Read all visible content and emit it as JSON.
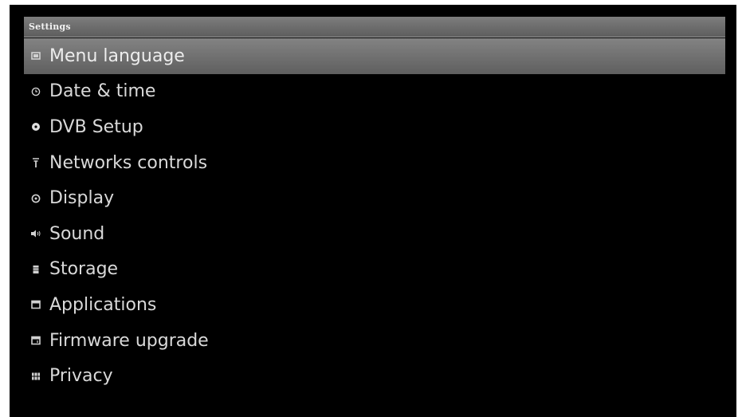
{
  "window": {
    "title": "Settings"
  },
  "menu": {
    "selected_index": 0,
    "items": [
      {
        "label": "Menu language",
        "icon": "flag-icon"
      },
      {
        "label": "Date & time",
        "icon": "clock-icon"
      },
      {
        "label": "DVB Setup",
        "icon": "dvb-icon"
      },
      {
        "label": "Networks controls",
        "icon": "antenna-icon"
      },
      {
        "label": "Display",
        "icon": "display-icon"
      },
      {
        "label": "Sound",
        "icon": "speaker-icon"
      },
      {
        "label": "Storage",
        "icon": "storage-icon"
      },
      {
        "label": "Applications",
        "icon": "applications-icon"
      },
      {
        "label": "Firmware upgrade",
        "icon": "firmware-icon"
      },
      {
        "label": "Privacy",
        "icon": "privacy-icon"
      }
    ]
  },
  "colors": {
    "background": "#000000",
    "highlight": "#717171",
    "text": "#d9d9d9",
    "title_bar": "#6e6e6e"
  }
}
